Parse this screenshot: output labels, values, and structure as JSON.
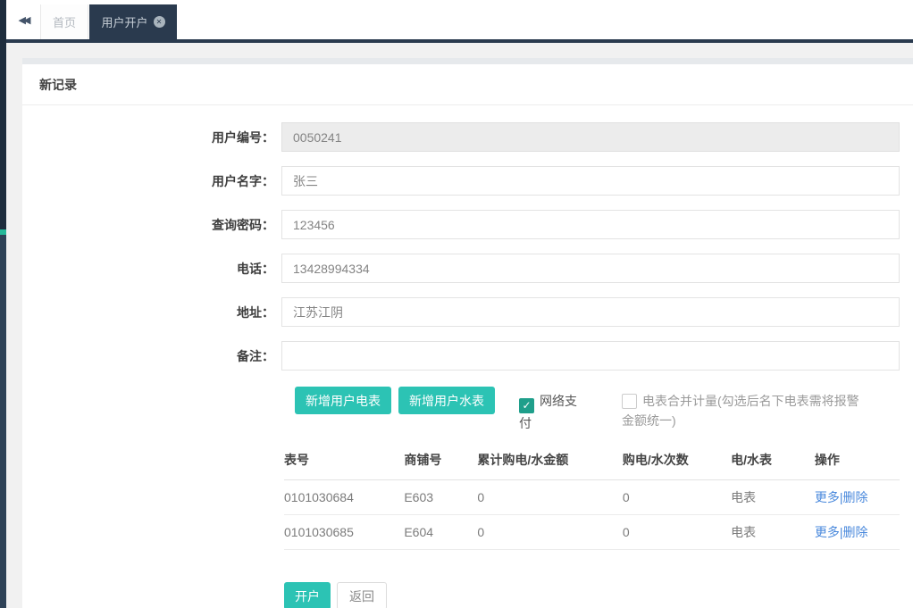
{
  "icons": {
    "collapse": "◀◀",
    "close": "✕",
    "check": "✓"
  },
  "tabs": [
    {
      "label": "首页"
    },
    {
      "label": "用户开户"
    }
  ],
  "panel": {
    "title": "新记录"
  },
  "form": {
    "fields": [
      {
        "label": "用户编号：",
        "value": "0050241",
        "disabled": true
      },
      {
        "label": "用户名字：",
        "value": "张三"
      },
      {
        "label": "查询密码：",
        "value": "123456"
      },
      {
        "label": "电话：",
        "value": "13428994334"
      },
      {
        "label": "地址：",
        "value": "江苏江阴"
      },
      {
        "label": "备注：",
        "value": ""
      }
    ],
    "buttons": {
      "add_electric_meter": "新增用户电表",
      "add_water_meter": "新增用户水表",
      "open_account": "开户",
      "back": "返回"
    },
    "checkboxes": [
      {
        "label": "网络支付",
        "checked": true
      },
      {
        "label": "电表合并计量(勾选后名下电表需将报警金额统一)",
        "checked": false
      }
    ]
  },
  "table": {
    "headers": [
      "表号",
      "商铺号",
      "累计购电/水金额",
      "购电/水次数",
      "电/水表",
      "操作"
    ],
    "rows": [
      {
        "meter_no": "0101030684",
        "shop_no": "E603",
        "total_amount": "0",
        "times": "0",
        "type": "电表",
        "action_more": "更多",
        "action_sep": "|",
        "action_delete": "删除"
      },
      {
        "meter_no": "0101030685",
        "shop_no": "E604",
        "total_amount": "0",
        "times": "0",
        "type": "电表",
        "action_more": "更多",
        "action_sep": "|",
        "action_delete": "删除"
      }
    ]
  },
  "colors": {
    "accent_teal": "#2cc3b4",
    "checkbox_checked_green": "#1f9f8b",
    "navy": "#2a3a4e",
    "link_blue": "#4a89dc",
    "sidebar_accent": "#26b99a"
  }
}
